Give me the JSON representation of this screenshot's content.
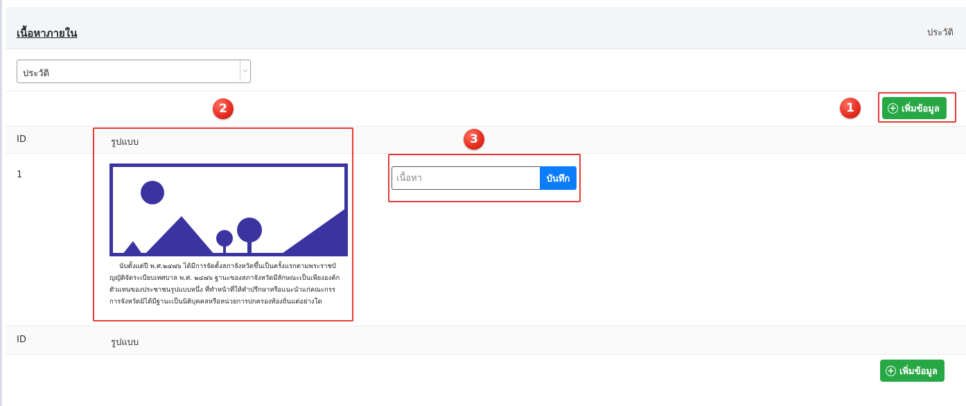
{
  "header": {
    "title": "เนื้อหาภายใน",
    "breadcrumb": "ประวัติ"
  },
  "filter": {
    "selected": "ประวัติ"
  },
  "actions": {
    "add_label": "เพิ่มข้อมูล"
  },
  "table": {
    "columns": [
      "ID",
      "รูปแบบ"
    ],
    "rows": [
      {
        "id": "1"
      }
    ]
  },
  "preview": {
    "lines": [
      "นับตั้งแต่ปี พ.ศ.๒๔๗๖ ได้มีการจัดตั้งสภาจังหวัดขึ้นเป็นครั้งแรกตามพระราชบั",
      "ญญัติจัดระเบียบเทศบาล พ.ศ. ๒๔๗๖ ฐานะของสภาจังหวัดมีลักษณะเป็นเพียงองค์ก",
      "ตัวแทนของประชาชนรูปแบบหนึ่ง ที่ทำหน้าที่ให้คำปรึกษาหรือแนะนำแก่คณะกรร",
      "การจังหวัดมิได้มีฐานะเป็นนิติบุคคลหรือหน่วยการปกครองท้องถิ่นแต่อย่างใด"
    ],
    "colors": {
      "primary": "#3a33a0"
    }
  },
  "editor": {
    "placeholder": "เนื้อหา",
    "save_label": "บันทึก"
  },
  "annotations": {
    "markers": [
      "1",
      "2",
      "3"
    ],
    "color": "#e53935"
  }
}
